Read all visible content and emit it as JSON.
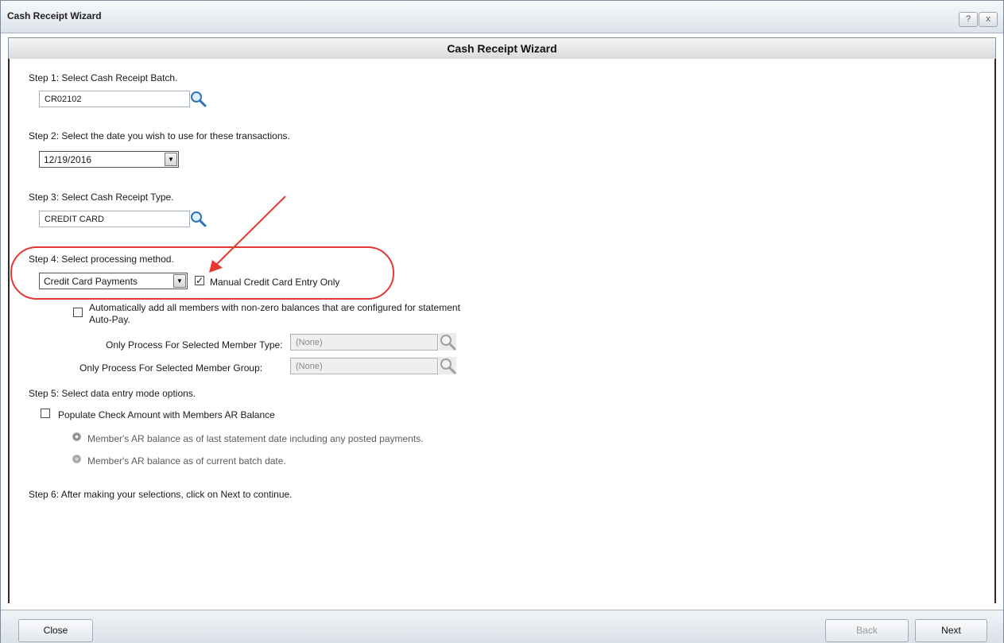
{
  "window": {
    "title": "Cash Receipt Wizard",
    "help_label": "?",
    "close_label": "x"
  },
  "header": {
    "title": "Cash Receipt Wizard"
  },
  "step1": {
    "label": "Step 1: Select Cash Receipt Batch.",
    "value": "CR02102"
  },
  "step2": {
    "label": "Step 2:  Select the date you wish to use for these transactions.",
    "value": "12/19/2016"
  },
  "step3": {
    "label": "Step 3: Select Cash Receipt Type.",
    "value": "CREDIT CARD"
  },
  "step4": {
    "label": "Step 4:  Select processing method.",
    "method": "Credit Card Payments",
    "manual_entry_label": "Manual Credit Card Entry Only",
    "manual_entry_checked": true,
    "autopay_label_line1": "Automatically add all members with non-zero balances that are configured for statement",
    "autopay_label_line2": "Auto-Pay.",
    "member_type_label": "Only Process For Selected Member Type:",
    "member_type_value": "(None)",
    "member_group_label": "Only Process For Selected Member Group:",
    "member_group_value": "(None)"
  },
  "step5": {
    "label": "Step 5: Select data entry mode options.",
    "populate_label": "Populate Check Amount with Members AR Balance",
    "radio1_label": "Member's AR balance as of last statement date including any posted payments.",
    "radio2_label": "Member's AR balance as of current batch date."
  },
  "step6": {
    "label": "Step 6: After making your selections, click on Next to continue."
  },
  "footer": {
    "close_label": "Close",
    "back_label": "Back",
    "next_label": "Next"
  },
  "colors": {
    "annotation_red": "#e53935"
  },
  "icons": {
    "lookup": "magnifier-icon",
    "dropdown": "chevron-down-icon"
  }
}
